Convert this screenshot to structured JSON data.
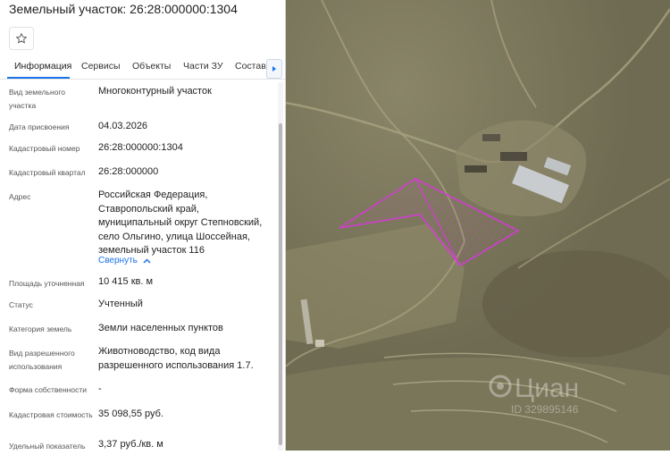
{
  "header": {
    "title": "Земельный участок: 26:28:000000:1304"
  },
  "tabs": [
    {
      "label": "Информация"
    },
    {
      "label": "Сервисы"
    },
    {
      "label": "Объекты"
    },
    {
      "label": "Части ЗУ"
    },
    {
      "label": "Состав"
    }
  ],
  "fields": {
    "land_type_label": "Вид земельного участка",
    "land_type_value": "Многоконтурный участок",
    "date_label": "Дата присвоения",
    "date_value": "04.03.2026",
    "cadastral_number_label": "Кадастровый номер",
    "cadastral_number_value": "26:28:000000:1304",
    "cadastral_quarter_label": "Кадастровый квартал",
    "cadastral_quarter_value": "26:28:000000",
    "address_label": "Адрес",
    "address_value": "Российская Федерация, Ставропольский край, муниципальный округ Степновский, село Ольгино, улица Шоссейная, земельный участок 116",
    "collapse_label": "Свернуть",
    "area_label": "Площадь уточненная",
    "area_value": "10 415 кв. м",
    "status_label": "Статус",
    "status_value": "Учтенный",
    "category_label": "Категория земель",
    "category_value": "Земли населенных пунктов",
    "usage_label": "Вид разрешенного использования",
    "usage_value": "Животноводство, код вида разрешенного использования 1.7.",
    "ownership_label": "Форма собственности",
    "ownership_value": "-",
    "cost_label": "Кадастровая стоимость",
    "cost_value": "35 098,55 руб.",
    "specific_label": "Удельный показатель",
    "specific_value": "3,37 руб./кв. м"
  },
  "map": {
    "watermark_logo": "Циан",
    "watermark_id": "ID 329895146",
    "parcel_color": "#d63ad6"
  },
  "colors": {
    "accent": "#1a73e8"
  }
}
